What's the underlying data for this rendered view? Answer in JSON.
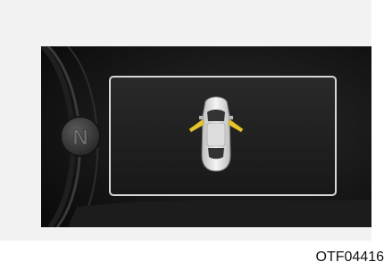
{
  "cluster": {
    "gear_indicator": "N",
    "alert": "door-open-warning",
    "open_doors": [
      "front-left",
      "front-right"
    ]
  },
  "caption": "OTF04416",
  "colors": {
    "panel_bg": "#141414",
    "display_border": "#d7d7d7",
    "door_warning": "#e7c531",
    "car_body": "#e9e9e9"
  }
}
